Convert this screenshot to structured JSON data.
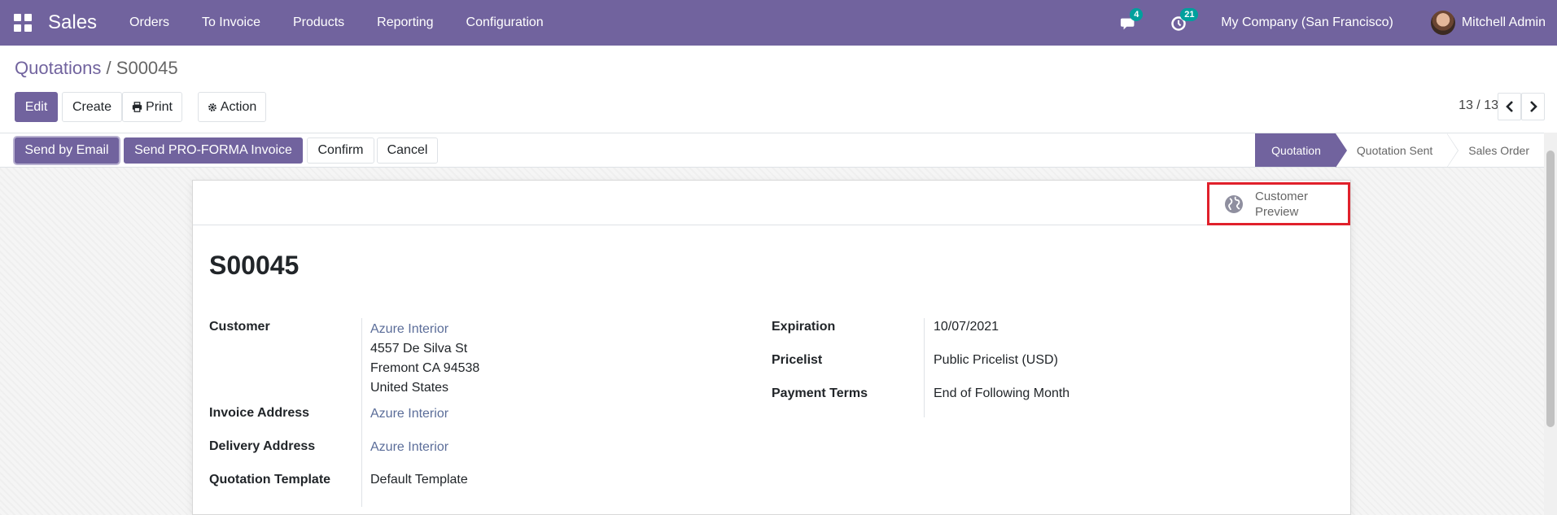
{
  "navbar": {
    "app_name": "Sales",
    "menu": [
      "Orders",
      "To Invoice",
      "Products",
      "Reporting",
      "Configuration"
    ],
    "messages_count": "4",
    "activities_count": "21",
    "company": "My Company (San Francisco)",
    "user": "Mitchell Admin"
  },
  "breadcrumb": {
    "parent": "Quotations",
    "separator": "/",
    "current": "S00045"
  },
  "toolbar": {
    "edit": "Edit",
    "create": "Create",
    "print": "Print",
    "action": "Action"
  },
  "pager": {
    "value": "13 / 13"
  },
  "status_buttons": {
    "send_email": "Send by Email",
    "send_proforma": "Send PRO-FORMA Invoice",
    "confirm": "Confirm",
    "cancel": "Cancel"
  },
  "status_steps": [
    "Quotation",
    "Quotation Sent",
    "Sales Order"
  ],
  "sheet": {
    "customer_preview_line1": "Customer",
    "customer_preview_line2": "Preview",
    "title": "S00045",
    "left_fields": {
      "customer_label": "Customer",
      "customer_name": "Azure Interior",
      "customer_address": [
        "4557 De Silva St",
        "Fremont CA 94538",
        "United States"
      ],
      "invoice_label": "Invoice Address",
      "invoice_value": "Azure Interior",
      "delivery_label": "Delivery Address",
      "delivery_value": "Azure Interior",
      "template_label": "Quotation Template",
      "template_value": "Default Template"
    },
    "right_fields": {
      "expiration_label": "Expiration",
      "expiration_value": "10/07/2021",
      "pricelist_label": "Pricelist",
      "pricelist_value": "Public Pricelist (USD)",
      "terms_label": "Payment Terms",
      "terms_value": "End of Following Month"
    }
  },
  "colors": {
    "brand": "#71639e",
    "badge": "#00a09d",
    "highlight": "#e0202b",
    "link": "#5b6d99"
  }
}
